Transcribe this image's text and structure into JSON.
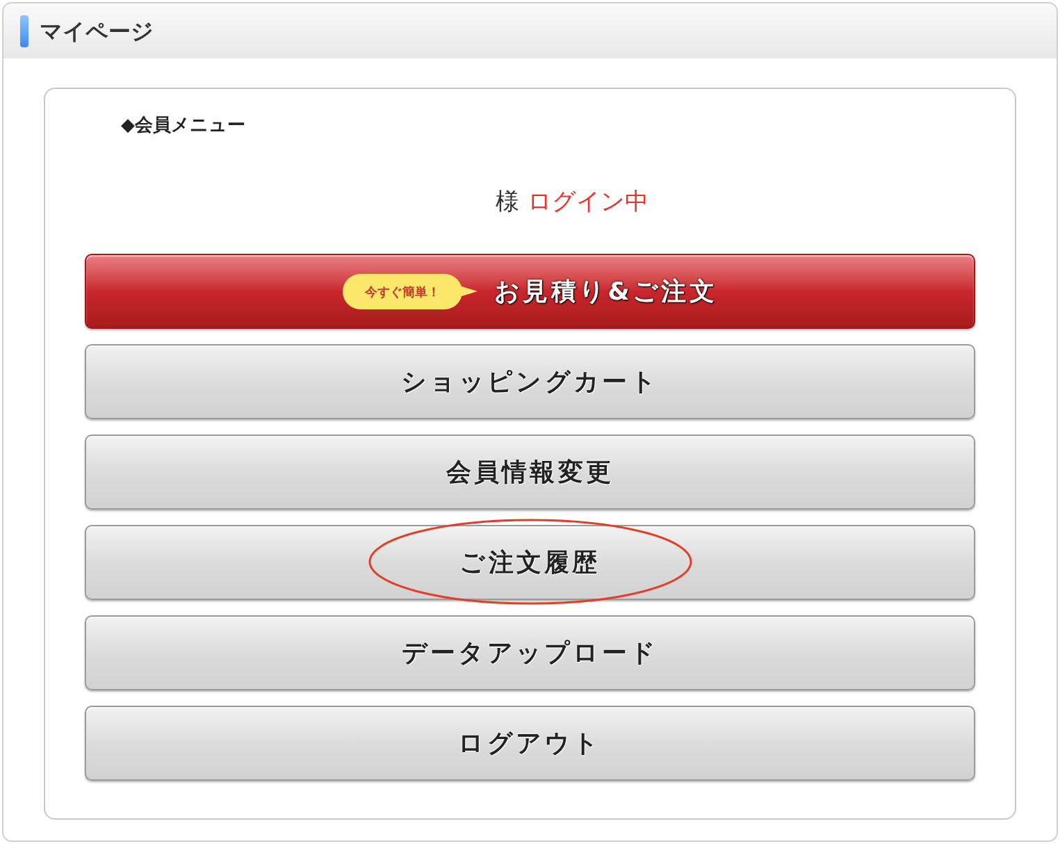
{
  "header": {
    "title": "マイページ"
  },
  "menu": {
    "heading": "◆会員メニュー",
    "login_status": {
      "suffix": "様",
      "status": "ログイン中"
    },
    "buttons": [
      {
        "kind": "primary",
        "badge": "今すぐ簡単！",
        "label": "お見積り&ご注文",
        "circled": false
      },
      {
        "kind": "secondary",
        "label": "ショッピングカート",
        "circled": false
      },
      {
        "kind": "secondary",
        "label": "会員情報変更",
        "circled": false
      },
      {
        "kind": "secondary",
        "label": "ご注文履歴",
        "circled": true
      },
      {
        "kind": "secondary",
        "label": "データアップロード",
        "circled": false
      },
      {
        "kind": "secondary",
        "label": "ログアウト",
        "circled": false
      }
    ]
  }
}
